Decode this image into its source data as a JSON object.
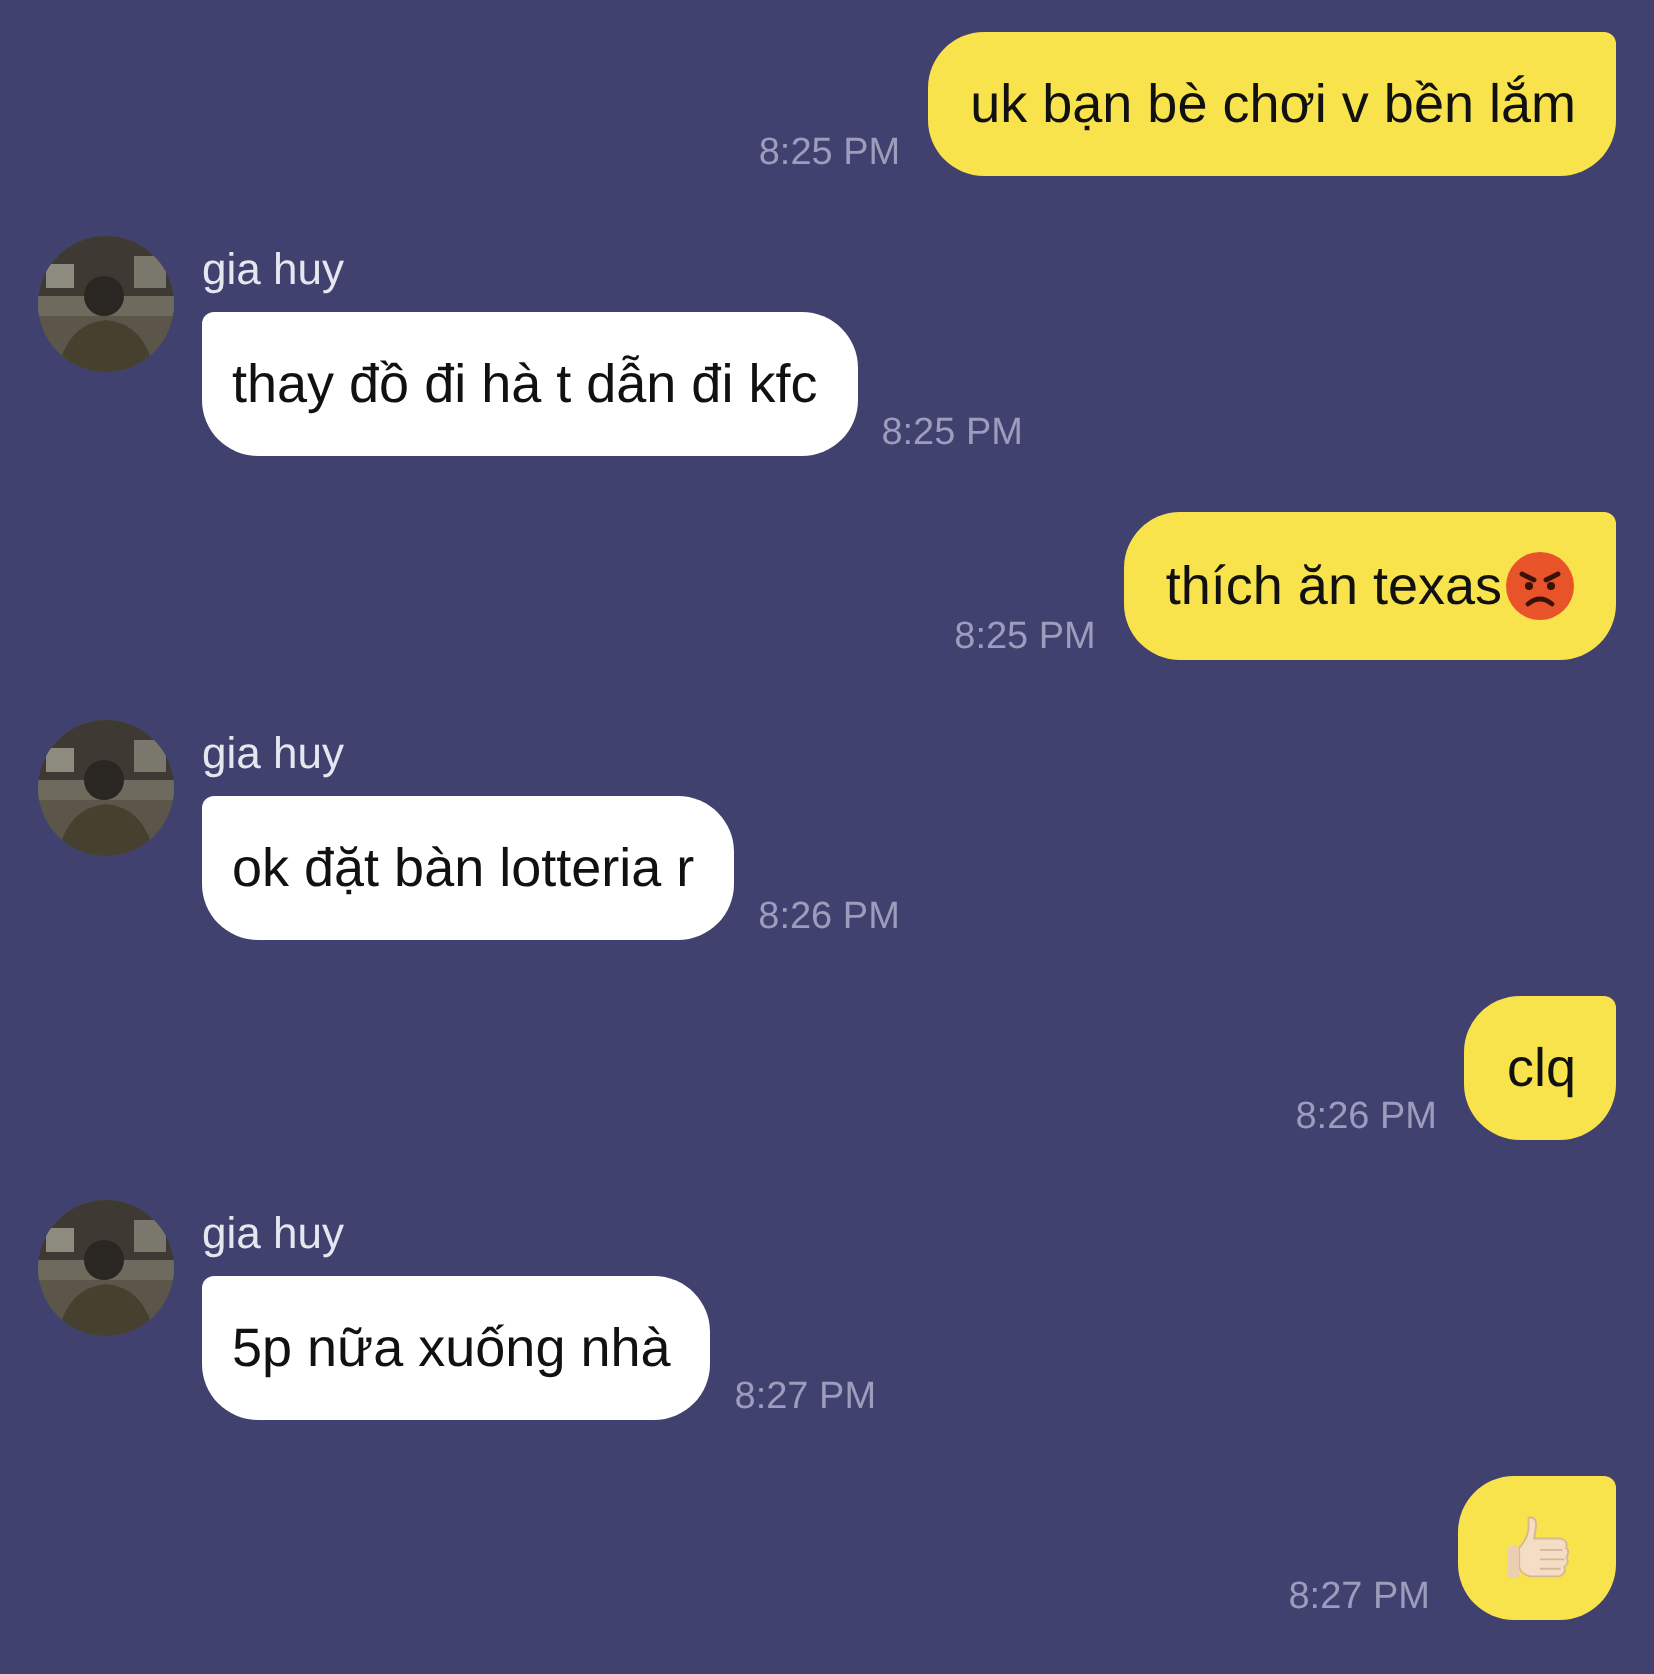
{
  "messages": [
    {
      "kind": "sent",
      "text": "uk bạn bè chơi v bền lắm",
      "time": "8:25 PM"
    },
    {
      "kind": "received",
      "sender": "gia huy",
      "text": "thay đồ đi hà t dẫn đi kfc",
      "time": "8:25 PM"
    },
    {
      "kind": "sent",
      "text": "thích ăn texas",
      "emoji": {
        "kind": "angry"
      },
      "time": "8:25 PM"
    },
    {
      "kind": "received",
      "sender": "gia huy",
      "text": "ok đặt bàn lotteria r",
      "time": "8:26 PM"
    },
    {
      "kind": "sent",
      "text": "clq",
      "time": "8:26 PM"
    },
    {
      "kind": "received",
      "sender": "gia huy",
      "text": "5p nữa xuống nhà",
      "time": "8:27 PM"
    },
    {
      "kind": "sent",
      "emoji": {
        "kind": "thumbs_up"
      },
      "time": "8:27 PM"
    }
  ]
}
